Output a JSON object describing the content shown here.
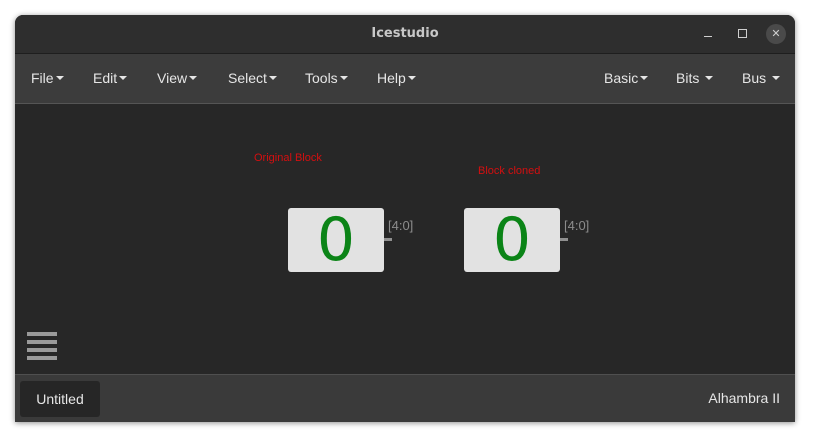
{
  "window": {
    "title": "Icestudio",
    "controls": {
      "minimize_icon": "minimize-icon",
      "maximize_icon": "maximize-icon",
      "close_icon": "close-icon",
      "close_glyph": "✕"
    }
  },
  "menubar": {
    "left": [
      {
        "label": "File"
      },
      {
        "label": "Edit"
      },
      {
        "label": "View"
      },
      {
        "label": "Select"
      },
      {
        "label": "Tools"
      },
      {
        "label": "Help"
      }
    ],
    "right": [
      {
        "label": "Basic"
      },
      {
        "label": "Bits"
      },
      {
        "label": "Bus"
      }
    ]
  },
  "canvas": {
    "blocks": [
      {
        "label": "Original Block",
        "value": "0",
        "port": "[4:0]"
      },
      {
        "label": "Block cloned",
        "value": "0",
        "port": "[4:0]"
      }
    ],
    "menu_icon": "hamburger-menu-icon"
  },
  "footer": {
    "project_name": "Untitled",
    "board": "Alhambra II"
  },
  "colors": {
    "background": "#272727",
    "block_label": "#d40f10",
    "block_value": "#0b8417",
    "block_body": "#e2e2e2"
  }
}
